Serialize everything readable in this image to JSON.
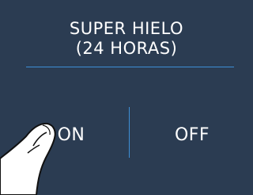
{
  "title": {
    "line1": "SUPER HIELO",
    "line2": "(24 HORAS)"
  },
  "options": {
    "on_label": "ON",
    "off_label": "OFF"
  },
  "colors": {
    "background": "#2b3c52",
    "accent_rule": "#3d8fd6",
    "text": "#ffffff"
  },
  "icons": {
    "pointer": "pointing-finger-icon"
  }
}
